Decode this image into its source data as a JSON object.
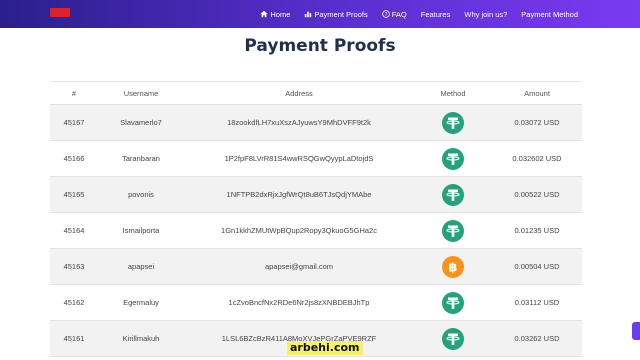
{
  "nav": {
    "items": [
      {
        "label": "Home",
        "icon": "home-icon"
      },
      {
        "label": "Payment Proofs",
        "icon": "chart-icon"
      },
      {
        "label": "FAQ",
        "icon": "question-icon"
      },
      {
        "label": "Features",
        "icon": ""
      },
      {
        "label": "Why join us?",
        "icon": ""
      },
      {
        "label": "Payment Method",
        "icon": ""
      }
    ]
  },
  "page": {
    "title": "Payment Proofs"
  },
  "table": {
    "headers": [
      "#",
      "Username",
      "Address",
      "Method",
      "Amount"
    ],
    "rows": [
      {
        "id": "45167",
        "username": "Slavamerlo7",
        "address": "18zookdfLH7xuXszAJyuwsY9MhDVFF9t2k",
        "method": "tether",
        "amount": "0.03072 USD"
      },
      {
        "id": "45166",
        "username": "Taranbaran",
        "address": "1P2fpF8LVrR81S4wwRSQGwQyypLaDtojdS",
        "method": "tether",
        "amount": "0.032602 USD"
      },
      {
        "id": "45165",
        "username": "povonis",
        "address": "1NFTPB2dxRjxJgfWrQt8uB6TJsQdjYMAbe",
        "method": "tether",
        "amount": "0.00522 USD"
      },
      {
        "id": "45164",
        "username": "Ismailporta",
        "address": "1Gn1kkhZMUtWpBQup2Ropy3QkuoG5GHa2c",
        "method": "tether",
        "amount": "0.01235 USD"
      },
      {
        "id": "45163",
        "username": "apapsei",
        "address": "apapsei@gmail.com",
        "method": "bitcoin",
        "amount": "0.00504 USD"
      },
      {
        "id": "45162",
        "username": "Egermaluy",
        "address": "1cZvoBncfNx2RDe6Nr2js8zXNBDEBJhTp",
        "method": "tether",
        "amount": "0.03112 USD"
      },
      {
        "id": "45161",
        "username": "Kirillmakuh",
        "address": "1LSL6BZcBzR411A8MoXVJePGrZaPVE9RZF",
        "method": "tether",
        "amount": "0.03262 USD"
      }
    ]
  },
  "watermark": {
    "text": "arbehi.com"
  },
  "colors": {
    "tether": "#26a17b",
    "bitcoin": "#f7931a",
    "nav_start": "#2a1f8c",
    "nav_end": "#7a3af0"
  }
}
